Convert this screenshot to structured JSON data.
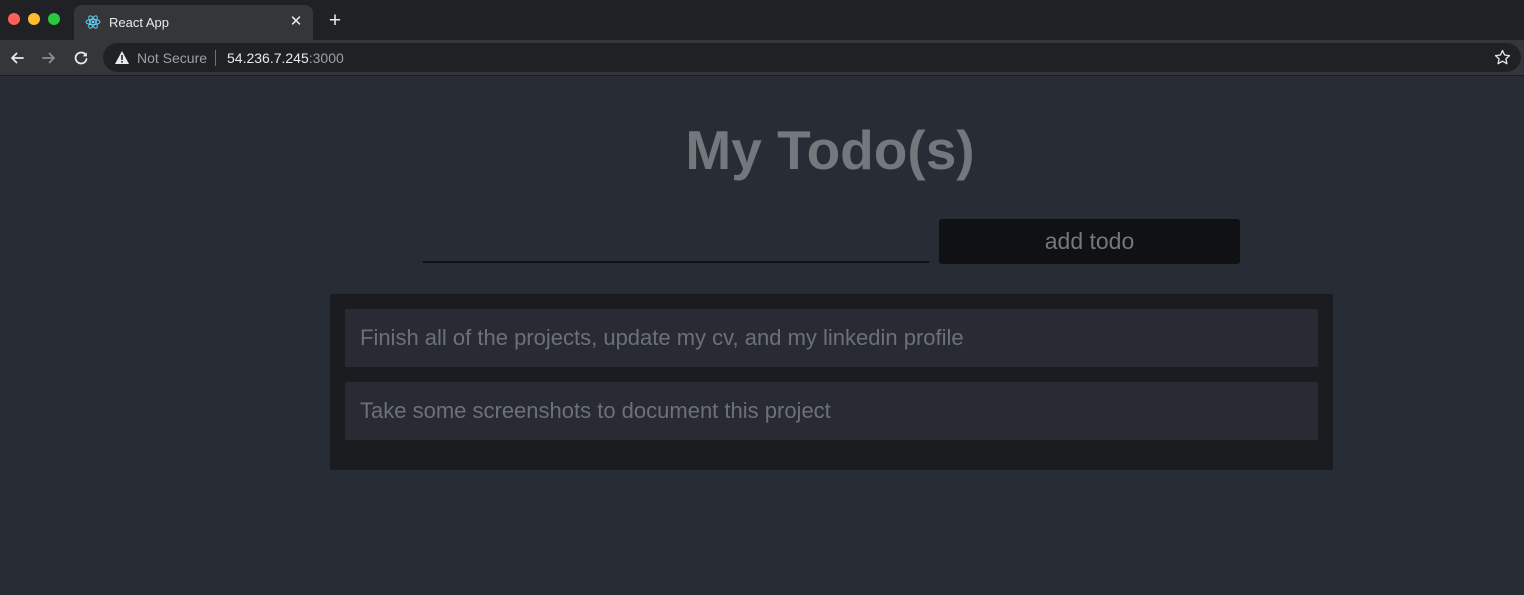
{
  "browser": {
    "tab": {
      "title": "React App",
      "close_label": "✕"
    },
    "new_tab_label": "+",
    "address_bar": {
      "security_label": "Not Secure",
      "host": "54.236.7.245",
      "port": ":3000"
    },
    "icons": [
      "react-logo-icon",
      "back-arrow-icon",
      "forward-arrow-icon",
      "reload-icon",
      "warning-icon",
      "star-icon"
    ]
  },
  "app": {
    "title": "My Todo(s)",
    "input": {
      "value": "",
      "placeholder": ""
    },
    "add_button_label": "add todo",
    "todos": [
      {
        "text": "Finish all of the projects, update my cv, and my linkedin profile"
      },
      {
        "text": "Take some screenshots to document this project"
      }
    ]
  },
  "colors": {
    "page_background": "#282c34",
    "list_background": "#1b1c1f",
    "item_background": "#282b33",
    "button_background": "#101113",
    "title_text": "#74777c"
  }
}
